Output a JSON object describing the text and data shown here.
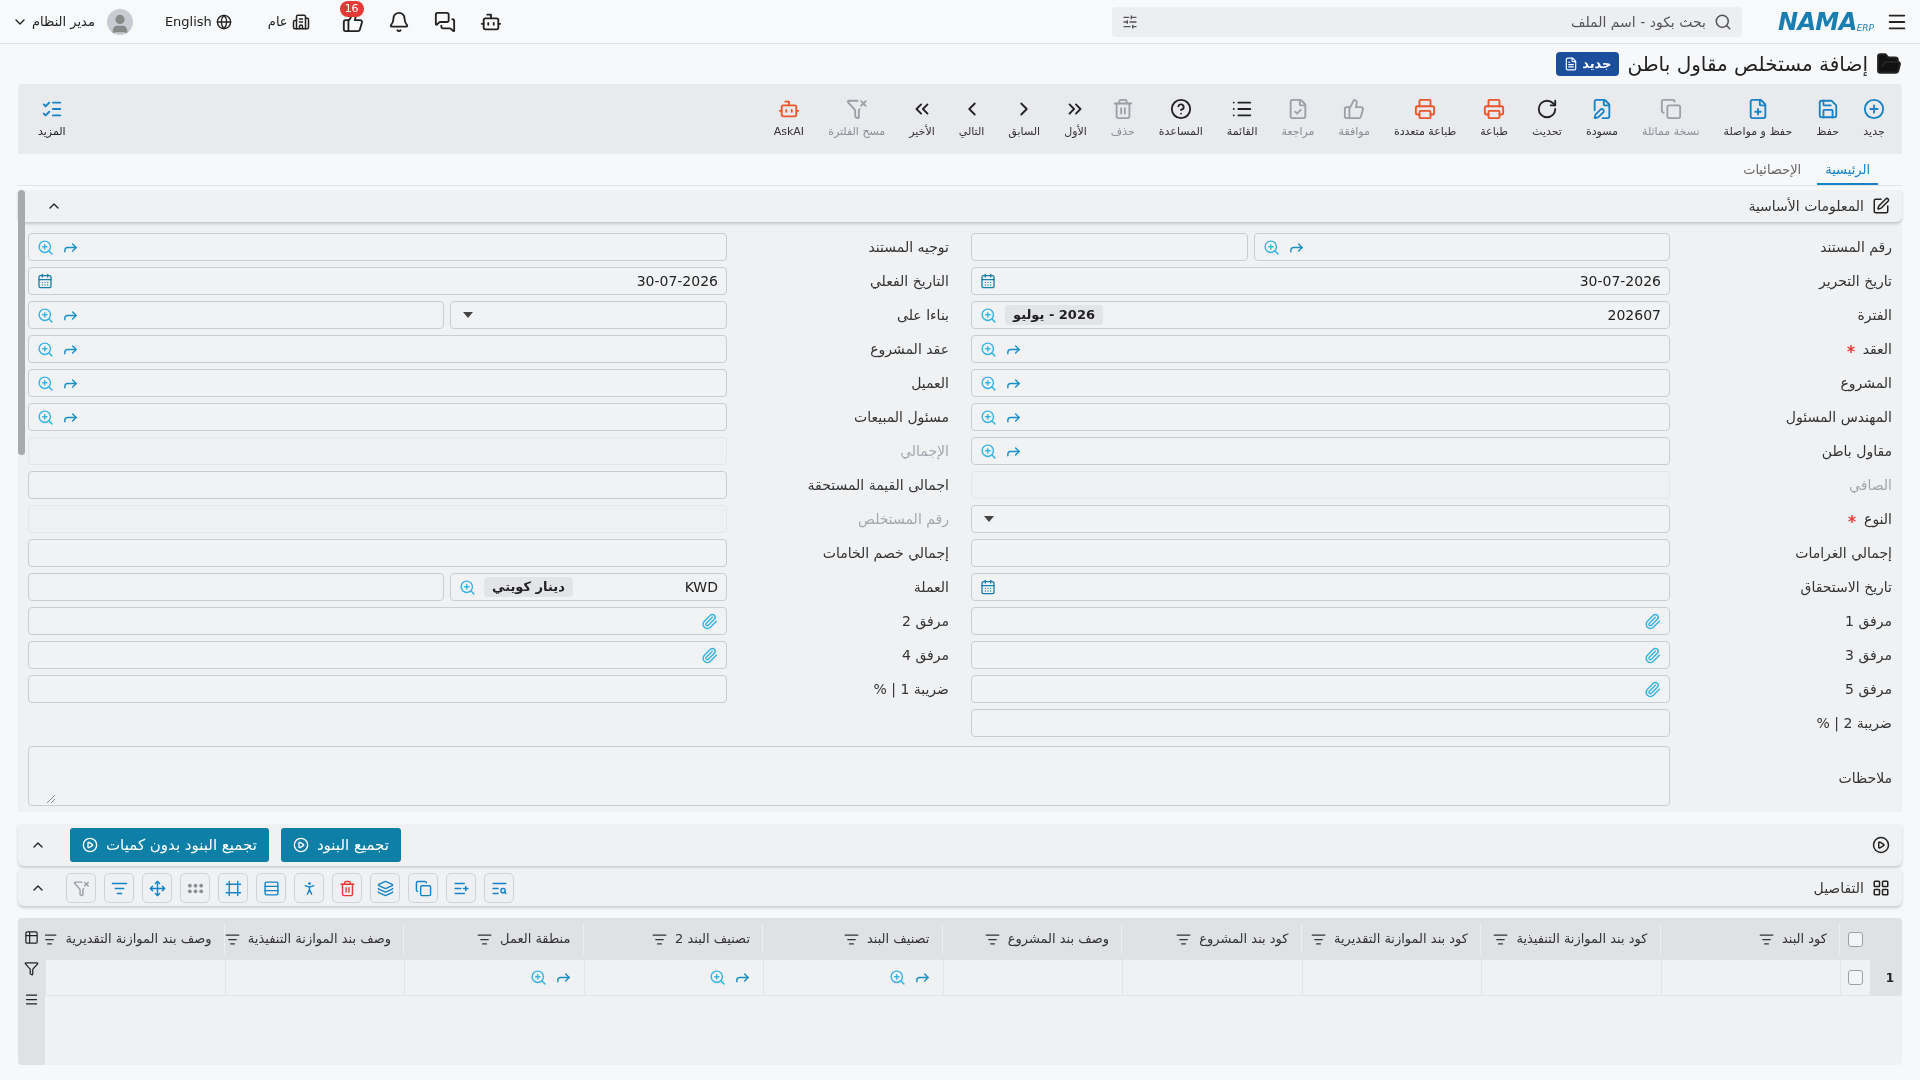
{
  "topbar": {
    "logo": {
      "name": "NAMA",
      "sub": "ERP"
    },
    "search_placeholder": "بحث بكود - اسم الملف",
    "notifications_count": "16",
    "branch": "عام",
    "language": "English",
    "user": "مدير النظام"
  },
  "header": {
    "title": "إضافة مستخلص مقاول باطن",
    "status": "جديد"
  },
  "toolbar": {
    "items": [
      {
        "label": "جديد",
        "color": "#1683c6",
        "disabled": false
      },
      {
        "label": "حفظ",
        "color": "#1683c6",
        "disabled": false
      },
      {
        "label": "حفظ و مواصلة",
        "color": "#1683c6",
        "disabled": false
      },
      {
        "label": "نسخة مماثلة",
        "color": "#9aa0a6",
        "disabled": true
      },
      {
        "label": "مسودة",
        "color": "#1683c6",
        "disabled": false
      },
      {
        "label": "تحديث",
        "color": "#222222",
        "disabled": false
      },
      {
        "label": "طباعة",
        "color": "#e8552a",
        "disabled": false
      },
      {
        "label": "طباعة متعددة",
        "color": "#e8552a",
        "disabled": false
      },
      {
        "label": "موافقة",
        "color": "#9aa0a6",
        "disabled": true
      },
      {
        "label": "مراجعة",
        "color": "#9aa0a6",
        "disabled": true
      },
      {
        "label": "القائمة",
        "color": "#222222",
        "disabled": false
      },
      {
        "label": "المساعدة",
        "color": "#222222",
        "disabled": false
      },
      {
        "label": "حذف",
        "color": "#9aa0a6",
        "disabled": true
      },
      {
        "label": "الأول",
        "color": "#222222",
        "disabled": false
      },
      {
        "label": "السابق",
        "color": "#222222",
        "disabled": false
      },
      {
        "label": "التالي",
        "color": "#222222",
        "disabled": false
      },
      {
        "label": "الأخير",
        "color": "#222222",
        "disabled": false
      },
      {
        "label": "مسح الفلترة",
        "color": "#9aa0a6",
        "disabled": true
      },
      {
        "label": "AskAI",
        "color": "#e8552a",
        "disabled": false
      }
    ],
    "more": "المزيد"
  },
  "tabs": [
    {
      "label": "الرئيسية",
      "selected": true
    },
    {
      "label": "الإحصائيات",
      "selected": false
    }
  ],
  "section": {
    "title": "المعلومات الأساسية",
    "expanded": true
  },
  "right_column": [
    {
      "label": "رقم المستند",
      "kind": "lookup_split",
      "required": false
    },
    {
      "label": "تاريخ التحرير",
      "kind": "date",
      "required": false,
      "value": "30-07-2026"
    },
    {
      "label": "الفترة",
      "kind": "period",
      "required": false,
      "value": "202607",
      "tag": "2026 - يوليو"
    },
    {
      "label": "العقد",
      "kind": "lookup",
      "required": true
    },
    {
      "label": "المشروع",
      "kind": "lookup",
      "required": false
    },
    {
      "label": "المهندس المسئول",
      "kind": "lookup",
      "required": false
    },
    {
      "label": "مقاول باطن",
      "kind": "lookup",
      "required": false
    },
    {
      "label": "الصافي",
      "kind": "readonly",
      "required": false
    },
    {
      "label": "النوع",
      "kind": "select",
      "required": true
    },
    {
      "label": "إجمالي الغرامات",
      "kind": "text",
      "required": false
    },
    {
      "label": "تاريخ الاستحقاق",
      "kind": "date",
      "required": false
    },
    {
      "label": "مرفق 1",
      "kind": "attachment",
      "required": false
    },
    {
      "label": "مرفق 3",
      "kind": "attachment",
      "required": false
    },
    {
      "label": "مرفق 5",
      "kind": "attachment",
      "required": false
    },
    {
      "label": "ضريبة 2 | %",
      "kind": "text",
      "required": false
    }
  ],
  "left_column": [
    {
      "label": "توجيه المستند",
      "kind": "lookup",
      "required": false
    },
    {
      "label": "التاريخ الفعلي",
      "kind": "date",
      "required": false,
      "value": "30-07-2026"
    },
    {
      "label": "بناءا على",
      "kind": "select_lookup",
      "required": false
    },
    {
      "label": "عقد المشروع",
      "kind": "lookup",
      "required": false
    },
    {
      "label": "العميل",
      "kind": "lookup",
      "required": false
    },
    {
      "label": "مسئول المبيعات",
      "kind": "lookup",
      "required": false
    },
    {
      "label": "الإجمالي",
      "kind": "readonly",
      "required": false
    },
    {
      "label": "اجمالى القيمة المستحقة",
      "kind": "text",
      "required": false
    },
    {
      "label": "رقم المستخلص",
      "kind": "readonly",
      "required": false
    },
    {
      "label": "إجمالي خصم الخامات",
      "kind": "text",
      "required": false
    },
    {
      "label": "العملة",
      "kind": "currency",
      "required": false,
      "value": "KWD",
      "tag": "دينار كويتي"
    },
    {
      "label": "مرفق 2",
      "kind": "attachment",
      "required": false
    },
    {
      "label": "مرفق 4",
      "kind": "attachment",
      "required": false
    },
    {
      "label": "ضريبة 1 | %",
      "kind": "text",
      "required": false
    }
  ],
  "notes": {
    "label": "ملاحظات"
  },
  "actions": {
    "buttons": [
      "تجميع البنود",
      "تجميع البنود بدون كميات"
    ],
    "expanded": true
  },
  "details": {
    "title": "التفاصيل",
    "expanded": true,
    "tools": [
      {
        "color": "#1683c6"
      },
      {
        "color": "#1683c6"
      },
      {
        "color": "#1683c6"
      },
      {
        "color": "#1683c6"
      },
      {
        "color": "#e53935"
      },
      {
        "color": "#1683c6"
      },
      {
        "color": "#1683c6"
      },
      {
        "color": "#1683c6"
      },
      {
        "color": "#8a8f96"
      },
      {
        "color": "#1683c6"
      },
      {
        "color": "#1683c6"
      },
      {
        "color": "#9aa0a6"
      }
    ]
  },
  "table": {
    "all_checked": false,
    "columns": [
      "كود البند",
      "كود بند الموازنة التنفيذية",
      "كود بند الموازنة التقديرية",
      "كود بند المشروع",
      "وصف بند المشروع",
      "تصنيف البند",
      "تصنيف البند 2",
      "منطقة العمل",
      "وصف بند الموازنة التنفيذية",
      "وصف بند الموازنة التقديرية"
    ],
    "rows": [
      {
        "number": "1",
        "checked": false,
        "cells": [
          {
            "kind": "empty"
          },
          {
            "kind": "empty"
          },
          {
            "kind": "empty"
          },
          {
            "kind": "empty"
          },
          {
            "kind": "empty"
          },
          {
            "kind": "lookup"
          },
          {
            "kind": "lookup"
          },
          {
            "kind": "lookup"
          },
          {
            "kind": "empty"
          },
          {
            "kind": "empty"
          }
        ]
      }
    ]
  }
}
